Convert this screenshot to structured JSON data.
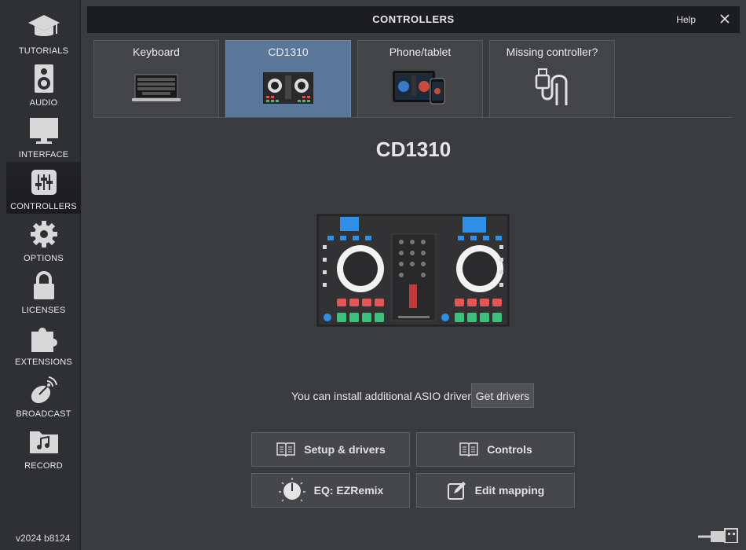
{
  "sidebar": {
    "items": [
      {
        "label": "TUTORIALS",
        "icon": "graduation-cap-icon"
      },
      {
        "label": "AUDIO",
        "icon": "speaker-icon"
      },
      {
        "label": "INTERFACE",
        "icon": "monitor-icon"
      },
      {
        "label": "CONTROLLERS",
        "icon": "sliders-icon",
        "active": true
      },
      {
        "label": "OPTIONS",
        "icon": "gear-icon"
      },
      {
        "label": "LICENSES",
        "icon": "lock-icon"
      },
      {
        "label": "EXTENSIONS",
        "icon": "puzzle-icon"
      },
      {
        "label": "BROADCAST",
        "icon": "satellite-dish-icon"
      },
      {
        "label": "RECORD",
        "icon": "music-folder-icon"
      }
    ],
    "version": "v2024 b8124"
  },
  "titlebar": {
    "title": "CONTROLLERS",
    "help_label": "Help"
  },
  "tabs": [
    {
      "label": "Keyboard",
      "icon": "laptop-keyboard-icon"
    },
    {
      "label": "CD1310",
      "icon": "dj-controller-icon",
      "active": true
    },
    {
      "label": "Phone/tablet",
      "icon": "tablet-phone-icon"
    },
    {
      "label": "Missing controller?",
      "icon": "usb-cable-icon"
    }
  ],
  "main": {
    "device_title": "CD1310",
    "asio_text": "You can install additional ASIO drivers",
    "get_drivers_label": "Get drivers",
    "buttons": {
      "setup": "Setup & drivers",
      "controls": "Controls",
      "eq": "EQ: EZRemix",
      "edit_mapping": "Edit mapping"
    }
  },
  "colors": {
    "accent_tab": "#5a779a",
    "background": "#3a3b3f",
    "sidebar": "#2f3034",
    "titlebar": "#1c1d20"
  }
}
